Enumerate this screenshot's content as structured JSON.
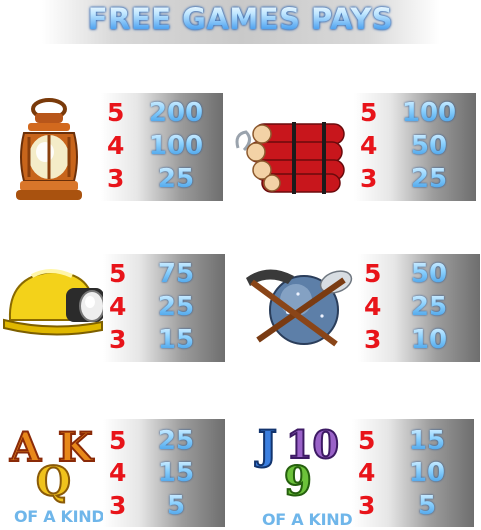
{
  "title": "FREE GAMES PAYS",
  "of_a_kind": "OF A KIND",
  "symbols": [
    {
      "icon": "lantern-icon",
      "pays": [
        {
          "count": "5",
          "value": "200"
        },
        {
          "count": "4",
          "value": "100"
        },
        {
          "count": "3",
          "value": "25"
        }
      ]
    },
    {
      "icon": "dynamite-icon",
      "pays": [
        {
          "count": "5",
          "value": "100"
        },
        {
          "count": "4",
          "value": "50"
        },
        {
          "count": "3",
          "value": "25"
        }
      ]
    },
    {
      "icon": "miner-helmet-icon",
      "pays": [
        {
          "count": "5",
          "value": "75"
        },
        {
          "count": "4",
          "value": "25"
        },
        {
          "count": "3",
          "value": "15"
        }
      ]
    },
    {
      "icon": "pickaxe-ore-icon",
      "pays": [
        {
          "count": "5",
          "value": "50"
        },
        {
          "count": "4",
          "value": "25"
        },
        {
          "count": "3",
          "value": "10"
        }
      ]
    },
    {
      "icon": "akq-cards-icon",
      "letters": [
        "A",
        "K",
        "Q"
      ],
      "pays": [
        {
          "count": "5",
          "value": "25"
        },
        {
          "count": "4",
          "value": "15"
        },
        {
          "count": "3",
          "value": "5"
        }
      ]
    },
    {
      "icon": "j109-cards-icon",
      "letters": [
        "J",
        "10",
        "9"
      ],
      "pays": [
        {
          "count": "5",
          "value": "15"
        },
        {
          "count": "4",
          "value": "10"
        },
        {
          "count": "3",
          "value": "5"
        }
      ]
    }
  ]
}
